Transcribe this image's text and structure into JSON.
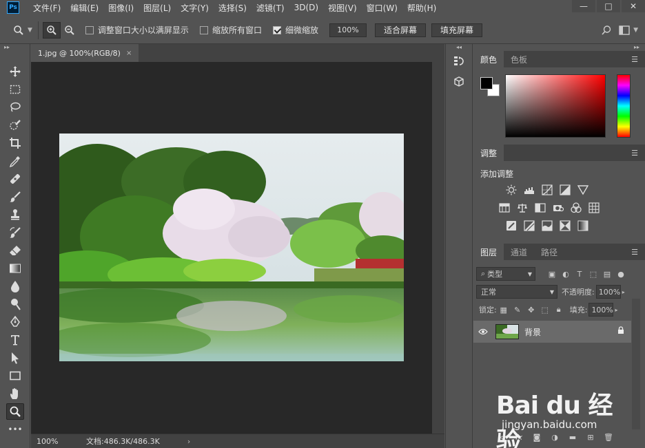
{
  "app": {
    "logo_text": "Ps"
  },
  "menu": [
    "文件(F)",
    "编辑(E)",
    "图像(I)",
    "图层(L)",
    "文字(Y)",
    "选择(S)",
    "滤镜(T)",
    "3D(D)",
    "视图(V)",
    "窗口(W)",
    "帮助(H)"
  ],
  "window_controls": {
    "minimize": "—",
    "maximize": "□",
    "close": "✕"
  },
  "options": {
    "resize_windows": {
      "label": "调整窗口大小以满屏显示",
      "checked": false
    },
    "zoom_all": {
      "label": "缩放所有窗口",
      "checked": false
    },
    "scrubby_zoom": {
      "label": "细微缩放",
      "checked": true
    },
    "zoom_value": "100%",
    "fit_screen": "适合屏幕",
    "fill_screen": "填充屏幕"
  },
  "document": {
    "tab_title": "1.jpg @ 100%(RGB/8)",
    "tab_close": "×"
  },
  "status": {
    "zoom": "100%",
    "info": "文档:486.3K/486.3K",
    "arrow": "›"
  },
  "panels": {
    "color_tabs": [
      "颜色",
      "色板"
    ],
    "adjust_tab": "调整",
    "adjust_title": "添加调整",
    "layers_tabs": [
      "图层",
      "通道",
      "路径"
    ],
    "kind_filter": "类型",
    "blend_mode": "正常",
    "opacity_label": "不透明度:",
    "opacity_value": "100%",
    "lock_label": "锁定:",
    "fill_label": "填充:",
    "fill_value": "100%",
    "layer_name": "背景"
  },
  "colors": {
    "foreground": "#000000",
    "background": "#ffffff"
  },
  "watermark": {
    "brand": "Bai du 经验",
    "url": "jingyan.baidu.com"
  }
}
